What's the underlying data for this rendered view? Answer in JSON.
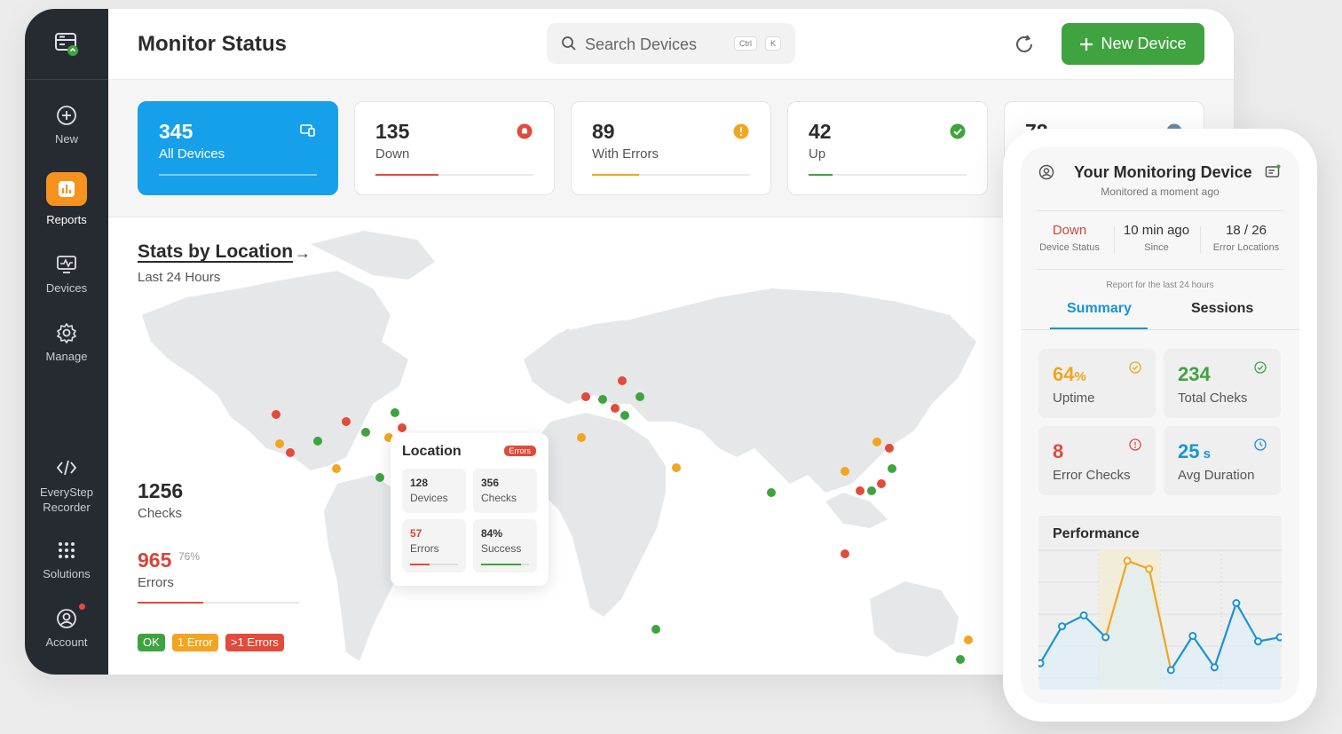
{
  "sidebar": {
    "items": [
      {
        "label": "New",
        "icon": "plus-circle-icon"
      },
      {
        "label": "Reports",
        "icon": "bar-chart-icon"
      },
      {
        "label": "Devices",
        "icon": "monitor-icon"
      },
      {
        "label": "Manage",
        "icon": "gear-icon"
      },
      {
        "label": "EveryStep Recorder",
        "icon": "code-icon"
      },
      {
        "label": "Solutions",
        "icon": "grid-icon"
      },
      {
        "label": "Account",
        "icon": "user-circle-icon"
      }
    ]
  },
  "header": {
    "title": "Monitor Status",
    "search_placeholder": "Search Devices",
    "shortcut_ctrl": "Ctrl",
    "shortcut_key": "K",
    "new_button": "New Device"
  },
  "stats": [
    {
      "value": "345",
      "label": "All Devices",
      "progress": 1.0
    },
    {
      "value": "135",
      "label": "Down",
      "progress": 0.4,
      "color": "#e24a3c"
    },
    {
      "value": "89",
      "label": "With Errors",
      "progress": 0.3,
      "color": "#f2a51f"
    },
    {
      "value": "42",
      "label": "Up",
      "progress": 0.15,
      "color": "#3fa33f"
    },
    {
      "value": "78"
    }
  ],
  "location": {
    "title": "Stats by Location",
    "subtitle": "Last 24 Hours",
    "checks_value": "1256",
    "checks_label": "Checks",
    "errors_value": "965",
    "errors_pct": "76%",
    "errors_label": "Errors",
    "errors_progress": 0.4,
    "legend": [
      "OK",
      "1 Error",
      ">1 Errors"
    ]
  },
  "popup": {
    "title": "Location",
    "badge": "Errors",
    "cells": [
      {
        "value": "128",
        "label": "Devices"
      },
      {
        "value": "356",
        "label": "Checks"
      },
      {
        "value": "57",
        "label": "Errors",
        "progress": 0.4
      },
      {
        "value": "84%",
        "label": "Success",
        "progress": 0.84
      }
    ]
  },
  "device": {
    "title": "Your Monitoring Device",
    "subtitle": "Monitored a moment ago",
    "status_value": "Down",
    "status_label": "Device Status",
    "since_value": "10 min ago",
    "since_label": "Since",
    "errloc_value": "18 / 26",
    "errloc_label": "Error Locations",
    "report_note": "Report for the last 24 hours",
    "tabs": [
      "Summary",
      "Sessions"
    ],
    "metrics": [
      {
        "value": "64",
        "unit": "%",
        "label": "Uptime",
        "color": "#f2a51f"
      },
      {
        "value": "234",
        "unit": "",
        "label": "Total Cheks",
        "color": "#3fa33f"
      },
      {
        "value": "8",
        "unit": "",
        "label": "Error Checks",
        "color": "#e24a3c"
      },
      {
        "value": "25",
        "unit": " s",
        "label": "Avg Duration",
        "color": "#1a93d6"
      }
    ],
    "performance_title": "Performance",
    "performance_values": [
      0.18,
      0.45,
      0.53,
      0.37,
      0.93,
      0.87,
      0.13,
      0.38,
      0.15,
      0.62,
      0.34,
      0.37
    ]
  }
}
